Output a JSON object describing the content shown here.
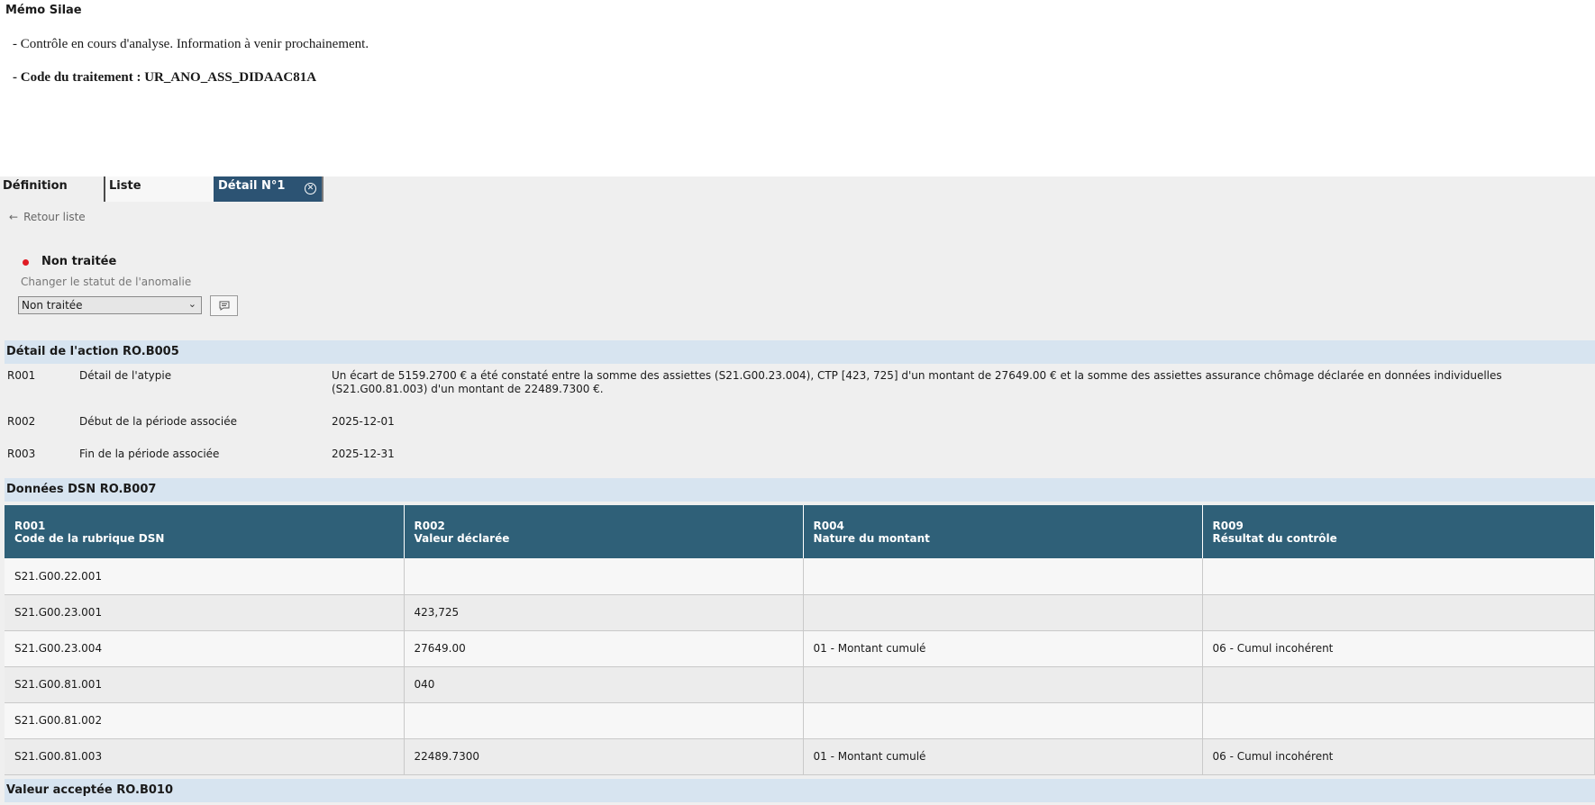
{
  "memo": {
    "title": "Mémo Silae",
    "line1": "- Contrôle en cours d'analyse. Information à venir prochainement.",
    "line2": "- Code du traitement : UR_ANO_ASS_DIDAAC81A"
  },
  "tabs": [
    {
      "label": "Définition"
    },
    {
      "label": "Liste"
    },
    {
      "label": "Détail N°1",
      "active": true
    }
  ],
  "back_label": "Retour liste",
  "status": {
    "current": "Non traitée",
    "hint": "Changer le statut de l'anomalie",
    "selected": "Non traitée",
    "color": "#e01b24"
  },
  "action_section": {
    "title": "Détail de l'action RO.B005",
    "rows": [
      {
        "code": "R001",
        "label": "Détail de l'atypie",
        "value": "Un écart de 5159.2700 € a été constaté entre la somme des assiettes (S21.G00.23.004), CTP [423, 725] d'un montant de 27649.00 € et la somme des assiettes assurance chômage déclarée en données individuelles (S21.G00.81.003) d'un montant de 22489.7300 €."
      },
      {
        "code": "R002",
        "label": "Début de la période associée",
        "value": "2025-12-01"
      },
      {
        "code": "R003",
        "label": "Fin de la période associée",
        "value": "2025-12-31"
      }
    ]
  },
  "dsn_section": {
    "title": "Données DSN RO.B007",
    "headers": [
      {
        "code": "R001",
        "label": "Code de la rubrique DSN"
      },
      {
        "code": "R002",
        "label": "Valeur déclarée"
      },
      {
        "code": "R004",
        "label": "Nature du montant"
      },
      {
        "code": "R009",
        "label": "Résultat du contrôle"
      }
    ],
    "rows": [
      [
        "S21.G00.22.001",
        "",
        "",
        ""
      ],
      [
        "S21.G00.23.001",
        "423,725",
        "",
        ""
      ],
      [
        "S21.G00.23.004",
        "27649.00",
        "01 - Montant cumulé",
        "06 - Cumul incohérent"
      ],
      [
        "S21.G00.81.001",
        "040",
        "",
        ""
      ],
      [
        "S21.G00.81.002",
        "",
        "",
        ""
      ],
      [
        "S21.G00.81.003",
        "22489.7300",
        "01 - Montant cumulé",
        "06 - Cumul incohérent"
      ]
    ]
  },
  "accepted_section": {
    "title": "Valeur acceptée RO.B010"
  },
  "icons": {
    "back": "arrow-left-icon",
    "close": "close-circle-icon",
    "comment": "comment-icon",
    "dropdown": "chevron-down-icon"
  }
}
